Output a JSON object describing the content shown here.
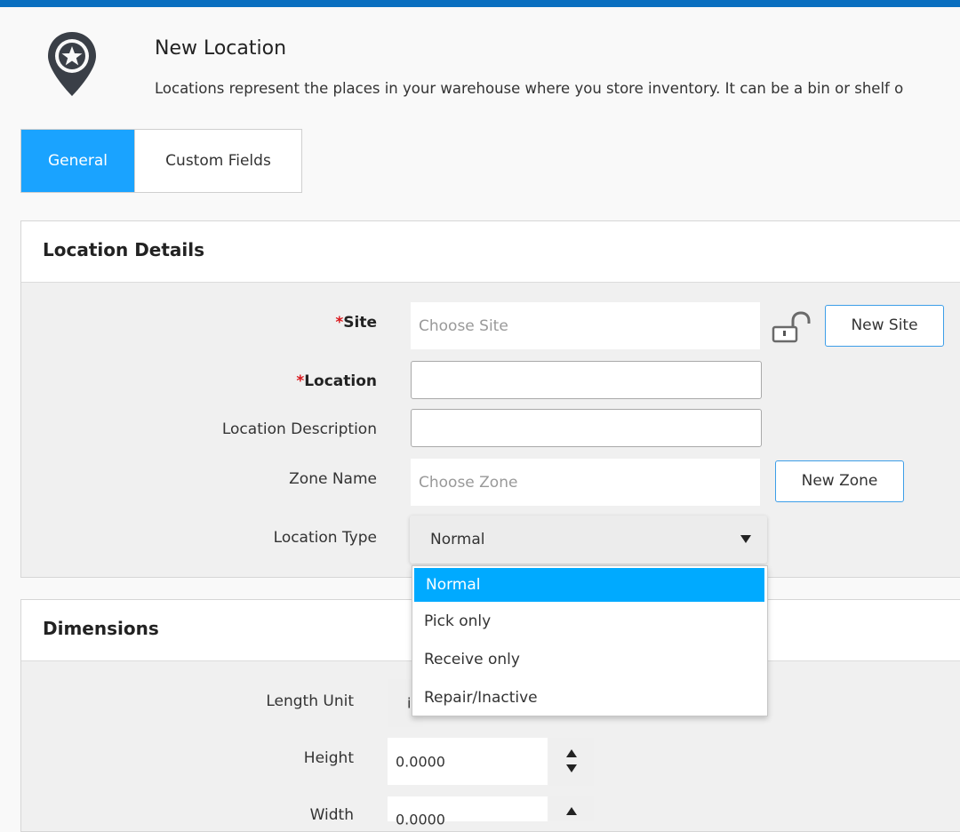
{
  "colors": {
    "topbar": "#0a6fc0",
    "tab_active": "#1aa3ff",
    "button_border": "#3d9ee8",
    "option_selected": "#00aaff",
    "required_star": "#d9181d"
  },
  "header": {
    "icon": "location-star-pin-icon",
    "title": "New Location",
    "description": "Locations represent the places in your warehouse where you store inventory. It can be a bin or shelf o"
  },
  "tabs": [
    {
      "label": "General",
      "active": true
    },
    {
      "label": "Custom Fields",
      "active": false
    }
  ],
  "location_details": {
    "title": "Location Details",
    "site": {
      "star": "*",
      "label": "Site",
      "placeholder": "Choose Site",
      "lock_icon": "unlock-icon",
      "new_button": "New Site"
    },
    "location": {
      "star": "*",
      "label": "Location",
      "value": ""
    },
    "description": {
      "label": "Location Description",
      "value": ""
    },
    "zone": {
      "label": "Zone Name",
      "placeholder": "Choose Zone",
      "new_button": "New Zone"
    },
    "location_type": {
      "label": "Location Type",
      "selected": "Normal",
      "options": [
        "Normal",
        "Pick only",
        "Receive only",
        "Repair/Inactive"
      ]
    }
  },
  "dimensions": {
    "title": "Dimensions",
    "length_unit": {
      "label": "Length Unit",
      "value_fragment": "i"
    },
    "height": {
      "label": "Height",
      "value": "0.0000"
    },
    "width": {
      "label": "Width",
      "value": "0.0000"
    }
  }
}
